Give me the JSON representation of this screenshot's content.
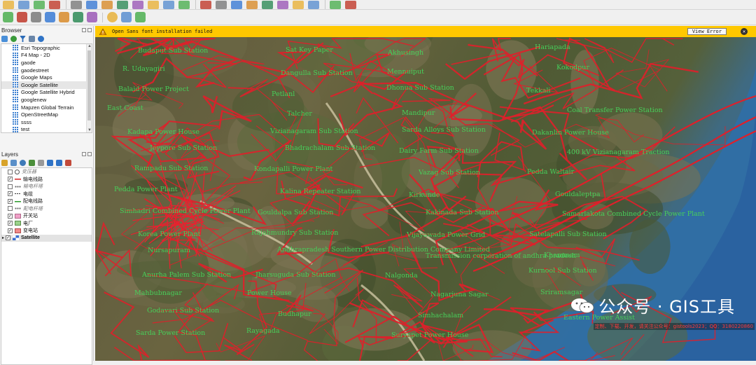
{
  "toolbar": {
    "row1_icons": [
      "new-project-icon",
      "open-project-icon",
      "save-icon",
      "digitize-icon",
      "edit-pencil-icon",
      "vertex-icon",
      "save-edits-icon",
      "cut-icon",
      "copy-icon",
      "paste-icon",
      "undo-icon",
      "redo-icon",
      "label-icon",
      "pin-icon",
      "attribute-icon",
      "add-layer-icon",
      "add-csv-icon",
      "add-raster-icon",
      "add-db-icon",
      "add-wms-icon",
      "gps-icon",
      "python-icon"
    ],
    "row2_icons": [
      "select-icon",
      "pan-icon",
      "zoom-in-icon",
      "zoom-out-icon",
      "zoom-full-icon",
      "measure-icon",
      "identify-icon",
      "globe-icon",
      "gear-icon",
      "tool-icon"
    ]
  },
  "browser": {
    "title": "Browser",
    "items": [
      {
        "label": "Esri Topographic"
      },
      {
        "label": "F4 Map - 2D"
      },
      {
        "label": "gaode"
      },
      {
        "label": "gaodestreet"
      },
      {
        "label": "Google Maps"
      },
      {
        "label": "Google Satellite",
        "selected": true
      },
      {
        "label": "Google Satellite Hybrid"
      },
      {
        "label": "googlenew"
      },
      {
        "label": "Mapzen Global Terrain"
      },
      {
        "label": "OpenStreetMap"
      },
      {
        "label": "ssss"
      },
      {
        "label": "test"
      }
    ]
  },
  "layers": {
    "title": "Layers",
    "items": [
      {
        "label": "变压器",
        "checked": false,
        "dim": true,
        "symbol": "circle"
      },
      {
        "label": "输电线路",
        "checked": true,
        "dim": false,
        "symbol": "red-line"
      },
      {
        "label": "输电杆塔",
        "checked": false,
        "dim": true,
        "symbol": "dots"
      },
      {
        "label": "电缆",
        "checked": true,
        "dim": false,
        "symbol": "dash"
      },
      {
        "label": "配电线路",
        "checked": true,
        "dim": false,
        "symbol": "green-line"
      },
      {
        "label": "配电杆塔",
        "checked": false,
        "dim": true,
        "symbol": "dots"
      },
      {
        "label": "开关站",
        "checked": true,
        "dim": false,
        "symbol": "pink-fill"
      },
      {
        "label": "电厂",
        "checked": true,
        "dim": false,
        "symbol": "green-fill"
      },
      {
        "label": "变电站",
        "checked": true,
        "dim": false,
        "symbol": "red-fill"
      },
      {
        "label": "Satellite",
        "checked": true,
        "dim": false,
        "symbol": "raster",
        "selected": true,
        "bold": true
      }
    ]
  },
  "message": {
    "text": "Open Sans font installation failed",
    "button": "View Error",
    "close": "✕"
  },
  "map_labels": [
    "Budaput Sub Station",
    "Sat Key Paper",
    "Akhusingh",
    "Hariapada",
    "R. Udayagiri",
    "Dangulla Sub Station",
    "Mennuiput",
    "Kokodpur",
    "Balaid Power Project",
    "Petlanl",
    "Dhonua Sub Station",
    "Tekkali",
    "East Coast",
    "Talcher",
    "Mandipur",
    "Coal Transfer Power Station",
    "Kadapa Power House",
    "Vizianagaram Sub Station",
    "Sarda Alloys Sub Station",
    "Dakanlin Power House",
    "Jeypore Sub Station",
    "Bhadrachalam Sub Station",
    "Dairy Farm Sub Station",
    "400 kV Vizianagaram Traction",
    "Rampadu Sub Station",
    "Kondapalli Power Plant",
    "Vazag Sub Station",
    "Pedda Waltair",
    "Pedda Power Plant",
    "Kalina Repeater Station",
    "Kirkunde",
    "Gouldaleptpa",
    "Simhadri Combined Cycle Power Plant",
    "Gouldalpa Sub Station",
    "Kakinada Sub Station",
    "Samarlakota Combined Cycle Power Plant",
    "Korea Power Plant",
    "Rajahmundry Sub Station",
    "Vijayawada Power Grid",
    "Satelapalli Sub Station",
    "Nursapuram",
    "Andhrapradesh Southern Power Distribution Company Limited",
    "Transmission corporation of andhra pradesh",
    "Khammam",
    "Anurha Palem Sub Station",
    "Jharsuguda Sub Station",
    "Nalgonda",
    "Kurnool Sub Station",
    "Mahbubnagar",
    "Power House",
    "Nagarjuna Sagar",
    "Sriramsagar",
    "Godavari Sub Station",
    "Budhapur",
    "Simhachalam",
    "Eastern Power Assist",
    "Sarda Power Station",
    "Rayagada",
    "Suryapet Power House"
  ],
  "watermark": {
    "text": "公众号 · GIS工具",
    "promo": "定制、下载、开发，请关注公众号：gistools2023；QQ：3180220860"
  }
}
